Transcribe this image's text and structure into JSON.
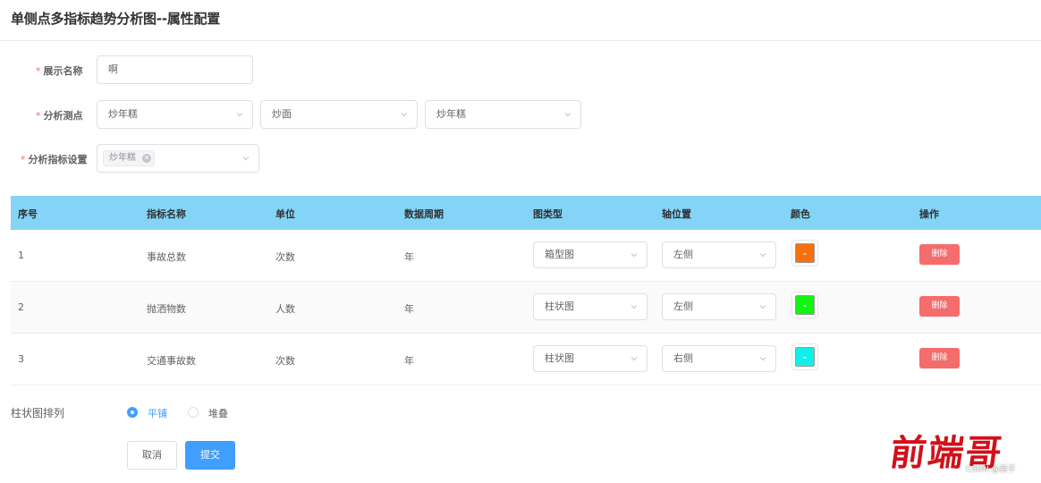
{
  "page": {
    "title": "单侧点多指标趋势分析图--属性配置"
  },
  "form": {
    "display_name": {
      "label": "展示名称",
      "required_mark": "*",
      "value": "啊"
    },
    "measure_point": {
      "label": "分析测点",
      "required_mark": "*",
      "selects": [
        "炒年糕",
        "炒面",
        "炒年糕"
      ]
    },
    "indicator_setting": {
      "label": "分析指标设置",
      "required_mark": "*",
      "tag": "炒年糕",
      "tag_close": "✕"
    }
  },
  "table": {
    "headers": [
      "序号",
      "指标名称",
      "单位",
      "数据周期",
      "图类型",
      "轴位置",
      "颜色",
      "操作"
    ],
    "rows": [
      {
        "index": "1",
        "name": "事故总数",
        "unit": "次数",
        "period": "年",
        "chart_type": "箱型图",
        "axis": "左侧",
        "color": "#f7700d",
        "action": "删除"
      },
      {
        "index": "2",
        "name": "抛洒物数",
        "unit": "人数",
        "period": "年",
        "chart_type": "柱状图",
        "axis": "左侧",
        "color": "#12f411",
        "action": "删除"
      },
      {
        "index": "3",
        "name": "交通事故数",
        "unit": "次数",
        "period": "年",
        "chart_type": "柱状图",
        "axis": "右侧",
        "color": "#11f0e8",
        "action": "删除"
      }
    ]
  },
  "bar_layout": {
    "label": "柱状图排列",
    "options": [
      "平铺",
      "堆叠"
    ],
    "selected": "平铺"
  },
  "buttons": {
    "cancel": "取消",
    "submit": "提交"
  },
  "watermark": {
    "text": "前端哥",
    "credit": "CSDN @弟子"
  },
  "icons": {
    "dropdown": "chevron-down-icon",
    "tag_close": "close-circle-icon",
    "color_dropdown": "chevron-down-icon"
  },
  "colors": {
    "table_header_bg": "#84d4f7",
    "primary": "#409eff",
    "danger": "#f56c6c",
    "required": "#f56c6c"
  }
}
